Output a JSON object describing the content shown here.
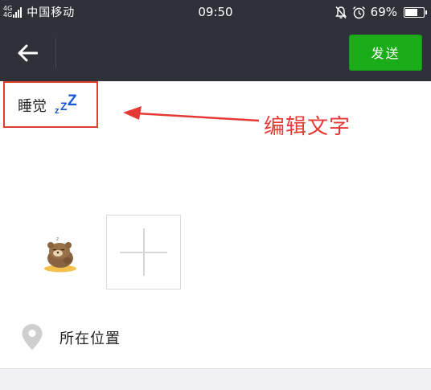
{
  "status_bar": {
    "network_top": "4G",
    "network_bottom": "4G",
    "carrier": "中国移动",
    "time": "09:50",
    "battery_percent": "69%",
    "battery_level": 0.69,
    "icons": [
      "signal-icon",
      "mute-bell-icon",
      "alarm-icon",
      "battery-icon"
    ]
  },
  "header": {
    "back_icon": "arrow-left-icon",
    "send_label": "发送",
    "send_color": "#1aad19",
    "background_color": "#2e3238"
  },
  "post": {
    "text": "睡觉",
    "zzz": [
      "z",
      "Z",
      "Z"
    ],
    "zzz_color": "#1a57d4"
  },
  "annotation": {
    "label": "编辑文字",
    "color": "#e53935"
  },
  "media": {
    "sticker_icon": "sleeping-bear-sticker",
    "add_icon": "plus-icon"
  },
  "location": {
    "icon": "location-pin-icon",
    "label": "所在位置"
  }
}
